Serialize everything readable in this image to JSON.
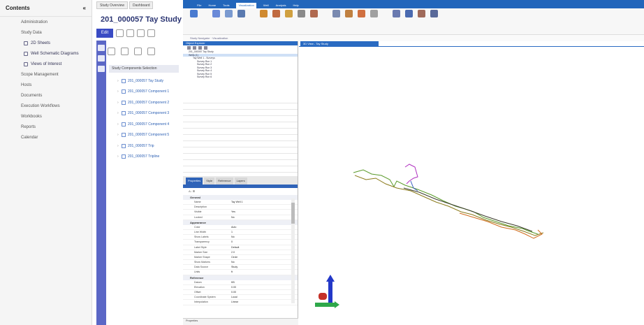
{
  "nav": {
    "title": "Contents",
    "items": [
      {
        "label": "Administration",
        "sub": false
      },
      {
        "label": "Study Data",
        "sub": false
      },
      {
        "label": "2D Sheets",
        "sub": true
      },
      {
        "label": "Well Schematic Diagrams",
        "sub": true
      },
      {
        "label": "Views of Interest",
        "sub": true
      },
      {
        "label": "Scope Management",
        "sub": false
      },
      {
        "label": "Hosts",
        "sub": false
      },
      {
        "label": "Documents",
        "sub": false
      },
      {
        "label": "Execution Workflows",
        "sub": false
      },
      {
        "label": "Workbooks",
        "sub": false
      },
      {
        "label": "Reports",
        "sub": false
      },
      {
        "label": "Calendar",
        "sub": false
      }
    ]
  },
  "study": {
    "tabs": [
      "Study Overview",
      "Dashboard"
    ],
    "title": "201_000057 Tay Study",
    "edit_label": "Edit",
    "section_label": "Study Components Selection",
    "rows": [
      "201_000057 Tay Study",
      "201_000057 Component 1",
      "201_000057 Component 2",
      "201_000057 Component 3",
      "201_000057 Component 4",
      "201_000057 Component 5",
      "201_000057 Trip",
      "201_000057 Tripline"
    ]
  },
  "ribbon": {
    "tabs": [
      "File",
      "Home",
      "Tools",
      "Visualization",
      "Well",
      "Analysis",
      "Help"
    ],
    "active_tab": "Visualization",
    "sub_label": "Study Navigator · Visualization"
  },
  "tree": {
    "title": "Object Explorer",
    "rows": [
      {
        "text": "201_000057 Tay Study",
        "level": 1,
        "selected": false
      },
      {
        "text": "Wells (1)",
        "level": 1,
        "selected": true
      },
      {
        "text": "Tay Well 1 - Surveys",
        "level": 2,
        "selected": false
      },
      {
        "text": "Survey Run 1",
        "level": 3,
        "selected": false
      },
      {
        "text": "Survey Run 2",
        "level": 3,
        "selected": false
      },
      {
        "text": "Survey Run 3",
        "level": 3,
        "selected": false
      },
      {
        "text": "Survey Run 4",
        "level": 3,
        "selected": false
      },
      {
        "text": "Survey Run 5",
        "level": 3,
        "selected": false
      },
      {
        "text": "Survey Run 6",
        "level": 3,
        "selected": false
      }
    ]
  },
  "props": {
    "tabs": [
      "Properties",
      "Style",
      "Reference",
      "Layers"
    ],
    "active_tab": "Properties",
    "tools_label": "A↓ ⊞",
    "sections": [
      {
        "title": "General",
        "rows": [
          {
            "k": "Name",
            "v": "Tay Well 1"
          },
          {
            "k": "Description",
            "v": ""
          },
          {
            "k": "Visible",
            "v": "Yes"
          },
          {
            "k": "Locked",
            "v": "No"
          }
        ]
      },
      {
        "title": "Appearance",
        "rows": [
          {
            "k": "Color",
            "v": "Auto"
          },
          {
            "k": "Line Width",
            "v": "1"
          },
          {
            "k": "Show Labels",
            "v": "No"
          },
          {
            "k": "Transparency",
            "v": "0"
          },
          {
            "k": "Label Style",
            "v": "Default"
          },
          {
            "k": "Marker Size",
            "v": "2.0"
          },
          {
            "k": "Marker Shape",
            "v": "Circle"
          },
          {
            "k": "Show Markers",
            "v": "No"
          },
          {
            "k": "Data Source",
            "v": "Study"
          },
          {
            "k": "Units",
            "v": "ft"
          }
        ]
      },
      {
        "title": "Reference",
        "rows": [
          {
            "k": "Datum",
            "v": "KB"
          },
          {
            "k": "Elevation",
            "v": "0.00"
          },
          {
            "k": "Offset",
            "v": "0.00"
          },
          {
            "k": "Coordinate System",
            "v": "Local"
          },
          {
            "k": "Interpolation",
            "v": "Linear"
          }
        ]
      }
    ],
    "footer": "Properties"
  },
  "viewport": {
    "tab_label": "3D View - Tay Study"
  },
  "colors": {
    "accent": "#2266bb",
    "strip": "#5b67c6",
    "edit": "#3a4bc4"
  }
}
